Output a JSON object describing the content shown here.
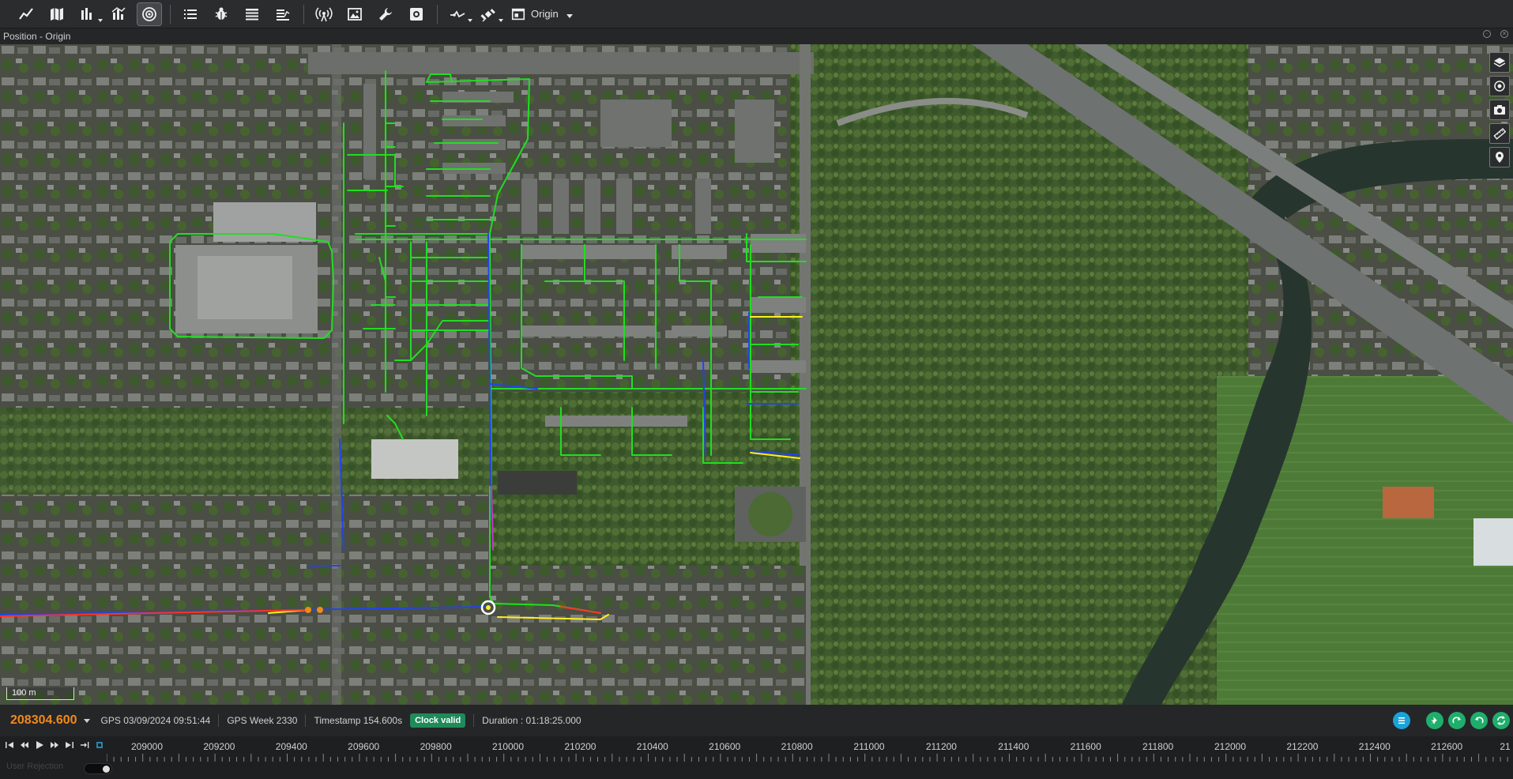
{
  "toolbar": {
    "origin_label": "Origin"
  },
  "panel": {
    "title": "Position - Origin"
  },
  "map": {
    "scale_label": "100 m"
  },
  "status": {
    "time_value": "208304.600",
    "gps_time": "GPS 03/09/2024 09:51:44",
    "gps_week": "GPS Week 2330",
    "timestamp": "Timestamp 154.600s",
    "clock_badge": "Clock valid",
    "duration": "Duration : 01:18:25.000"
  },
  "timeline": {
    "ticks": [
      "209000",
      "209200",
      "209400",
      "209600",
      "209800",
      "210000",
      "210200",
      "210400",
      "210600",
      "210800",
      "211000",
      "211200",
      "211400",
      "211600",
      "211800",
      "212000",
      "212200",
      "212400",
      "212600",
      "21"
    ],
    "user_rejection_label": "User Rejection"
  },
  "colors": {
    "accent_orange": "#f08a1c",
    "badge_green": "#1f8a5a",
    "track_green": "#22dd22",
    "track_blue": "#2233dd",
    "track_yellow": "#ffee22",
    "track_red": "#ff3322"
  }
}
